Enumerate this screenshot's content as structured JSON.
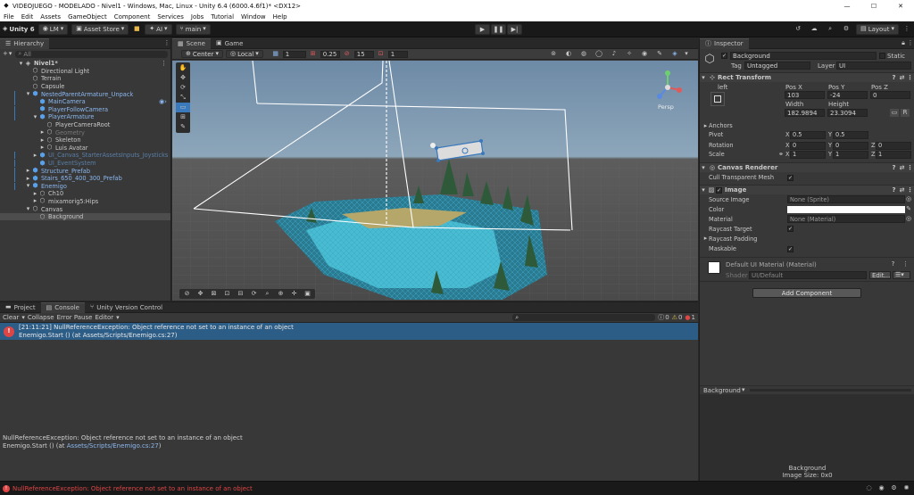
{
  "window": {
    "title": "VIDEOJUEGO - MODELADO - Nivel1 - Windows, Mac, Linux - Unity 6.4 (6000.4.6f1)* <DX12>",
    "minimize": "—",
    "maximize": "☐",
    "close": "✕"
  },
  "menu": [
    "File",
    "Edit",
    "Assets",
    "GameObject",
    "Component",
    "Services",
    "Jobs",
    "Tutorial",
    "Window",
    "Help"
  ],
  "toolbar": {
    "unity": "Unity 6",
    "account": "LM",
    "asset_store": "Asset Store",
    "ai": "AI",
    "branch": "main",
    "layout": "Layout"
  },
  "hierarchy": {
    "tab": "Hierarchy",
    "search_placeholder": "All",
    "items": [
      {
        "label": "Nivel1*",
        "level": 0,
        "style": "bold",
        "icon": "unity-scene-icon",
        "arrow": "▾"
      },
      {
        "label": "Directional Light",
        "level": 1,
        "style": "normal",
        "icon": "cube-icon",
        "arrow": ""
      },
      {
        "label": "Terrain",
        "level": 1,
        "style": "normal",
        "icon": "cube-icon",
        "arrow": ""
      },
      {
        "label": "Capsule",
        "level": 1,
        "style": "normal",
        "icon": "cube-icon",
        "arrow": ""
      },
      {
        "label": "NestedParentArmature_Unpack",
        "level": 1,
        "style": "blue",
        "icon": "prefab-icon",
        "arrow": "▾"
      },
      {
        "label": "MainCamera",
        "level": 2,
        "style": "blue",
        "icon": "prefab-icon",
        "arrow": ""
      },
      {
        "label": "PlayerFollowCamera",
        "level": 2,
        "style": "blue",
        "icon": "prefab-icon",
        "arrow": ""
      },
      {
        "label": "PlayerArmature",
        "level": 2,
        "style": "blue",
        "icon": "prefab-icon",
        "arrow": "▾"
      },
      {
        "label": "PlayerCameraRoot",
        "level": 3,
        "style": "normal",
        "icon": "cube-icon",
        "arrow": ""
      },
      {
        "label": "Geometry",
        "level": 3,
        "style": "dim",
        "icon": "cube-icon",
        "arrow": "▸"
      },
      {
        "label": "Skeleton",
        "level": 3,
        "style": "normal",
        "icon": "cube-icon",
        "arrow": "▸"
      },
      {
        "label": "Luis Avatar",
        "level": 3,
        "style": "normal",
        "icon": "cube-icon",
        "arrow": "▸"
      },
      {
        "label": "UI_Canvas_StarterAssetsInputs_Joysticks",
        "level": 2,
        "style": "dimblue",
        "icon": "prefab-icon",
        "arrow": "▸"
      },
      {
        "label": "UI_EventSystem",
        "level": 2,
        "style": "dimblue",
        "icon": "prefab-icon",
        "arrow": ""
      },
      {
        "label": "Structure_Prefab",
        "level": 1,
        "style": "blue",
        "icon": "prefab-icon",
        "arrow": "▸"
      },
      {
        "label": "Stairs_650_400_300_Prefab",
        "level": 1,
        "style": "blue",
        "icon": "prefab-icon",
        "arrow": "▸"
      },
      {
        "label": "Enemigo",
        "level": 1,
        "style": "blue",
        "icon": "prefab-icon",
        "arrow": "▾"
      },
      {
        "label": "Ch10",
        "level": 2,
        "style": "normal",
        "icon": "cube-icon",
        "arrow": "▸"
      },
      {
        "label": "mixamorig5:Hips",
        "level": 2,
        "style": "normal",
        "icon": "cube-icon",
        "arrow": "▸"
      },
      {
        "label": "Canvas",
        "level": 1,
        "style": "normal",
        "icon": "cube-icon",
        "arrow": "▾"
      },
      {
        "label": "Background",
        "level": 2,
        "style": "selected",
        "icon": "cube-icon",
        "arrow": ""
      }
    ]
  },
  "scene": {
    "tabs": [
      "Scene",
      "Game"
    ],
    "pivot": "Center",
    "space": "Local",
    "grid": "1",
    "snap": "0.25",
    "angle": "15",
    "scale": "1",
    "view": "Persp"
  },
  "bottom": {
    "tabs": [
      "Project",
      "Console",
      "Unity Version Control"
    ],
    "clear": "Clear",
    "collapse": "Collapse",
    "error_pause": "Error Pause",
    "editor": "Editor",
    "count_info": "0",
    "count_warn": "0",
    "count_err": "1",
    "log": {
      "time": "[21:11:21]",
      "line1": "NullReferenceException: Object reference not set to an instance of an object",
      "line2": "Enemigo.Start () (at Assets/Scripts/Enemigo.cs:27)"
    },
    "detail": {
      "line1": "NullReferenceException: Object reference not set to an instance of an object",
      "line2_prefix": "Enemigo.Start () (at ",
      "line2_link": "Assets/Scripts/Enemigo.cs:27",
      "line2_suffix": ")"
    }
  },
  "inspector": {
    "tab": "Inspector",
    "name": "Background",
    "static": "Static",
    "tag_label": "Tag",
    "tag": "Untagged",
    "layer_label": "Layer",
    "layer": "UI",
    "rect_title": "Rect Transform",
    "anchor_label": "left",
    "posx_label": "Pos X",
    "posy_label": "Pos Y",
    "posz_label": "Pos Z",
    "posx": "103",
    "posy": "-24",
    "posz": "0",
    "width_label": "Width",
    "height_label": "Height",
    "width": "182.9894",
    "height": "23.3094",
    "anchors": "Anchors",
    "pivot_label": "Pivot",
    "pivot_x": "0.5",
    "pivot_y": "0.5",
    "rotation_label": "Rotation",
    "rot_x": "0",
    "rot_y": "0",
    "rot_z": "0",
    "scale_label": "Scale",
    "scale_x": "1",
    "scale_y": "1",
    "scale_z": "1",
    "canvas_renderer": "Canvas Renderer",
    "cull": "Cull Transparent Mesh",
    "image_title": "Image",
    "source_image_label": "Source Image",
    "source_image": "None (Sprite)",
    "color_label": "Color",
    "material_label": "Material",
    "material": "None (Material)",
    "raycast_target": "Raycast Target",
    "raycast_padding": "Raycast Padding",
    "maskable": "Maskable",
    "default_material": "Default UI Material (Material)",
    "shader_label": "Shader",
    "shader": "UI/Default",
    "edit": "Edit...",
    "add_component": "Add Component",
    "preview_label": "Background",
    "preview_name": "Background",
    "preview_size": "Image Size: 0x0"
  },
  "status": {
    "message": "NullReferenceException: Object reference not set to an instance of an object"
  },
  "colors": {
    "accent": "#3a79bb",
    "error": "#e04545",
    "log_selected": "#2c5d87"
  }
}
